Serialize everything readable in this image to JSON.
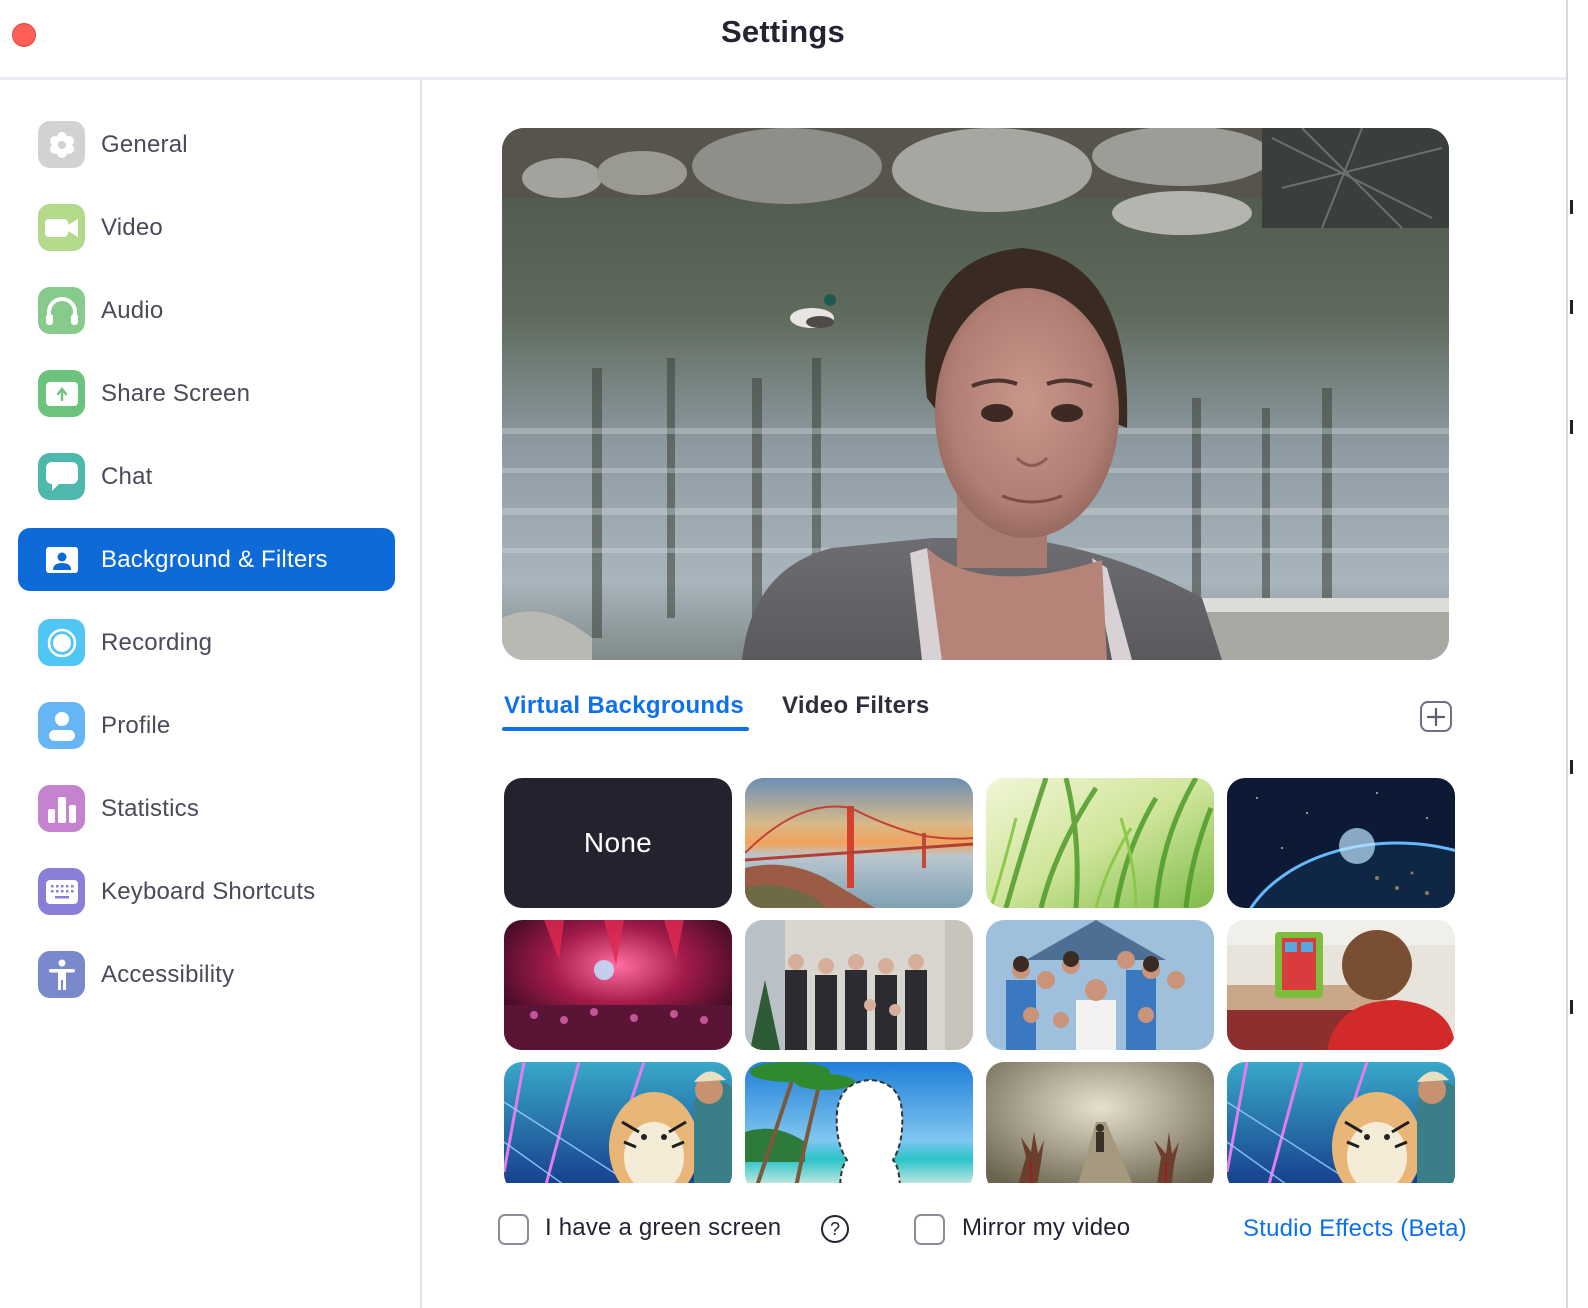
{
  "window": {
    "title": "Settings"
  },
  "sidebar": {
    "items": [
      {
        "id": "general",
        "label": "General",
        "icon": "gear-icon",
        "color": "#d2d2d4",
        "active": false
      },
      {
        "id": "video",
        "label": "Video",
        "icon": "video-camera-icon",
        "color": "#b5d98b",
        "active": false
      },
      {
        "id": "audio",
        "label": "Audio",
        "icon": "headphones-icon",
        "color": "#86cb8b",
        "active": false
      },
      {
        "id": "share-screen",
        "label": "Share Screen",
        "icon": "share-screen-icon",
        "color": "#6cc37b",
        "active": false
      },
      {
        "id": "chat",
        "label": "Chat",
        "icon": "chat-bubble-icon",
        "color": "#4db8ac",
        "active": false
      },
      {
        "id": "background-filters",
        "label": "Background & Filters",
        "icon": "person-card-icon",
        "color": "#0e6ad6",
        "active": true
      },
      {
        "id": "recording",
        "label": "Recording",
        "icon": "record-icon",
        "color": "#4fc6f4",
        "active": false
      },
      {
        "id": "profile",
        "label": "Profile",
        "icon": "person-icon",
        "color": "#66b6f6",
        "active": false
      },
      {
        "id": "statistics",
        "label": "Statistics",
        "icon": "bar-chart-icon",
        "color": "#c583cf",
        "active": false
      },
      {
        "id": "keyboard-shortcuts",
        "label": "Keyboard Shortcuts",
        "icon": "keyboard-icon",
        "color": "#8a7fd6",
        "active": false
      },
      {
        "id": "accessibility",
        "label": "Accessibility",
        "icon": "accessibility-icon",
        "color": "#7a88cc",
        "active": false
      }
    ]
  },
  "main": {
    "preview": {
      "description": "Camera preview: person with virtual background of a pond with rocks and a duck"
    },
    "tabs": [
      {
        "label": "Virtual Backgrounds",
        "active": true
      },
      {
        "label": "Video Filters",
        "active": false
      }
    ],
    "add_button_label": "+",
    "backgrounds": [
      {
        "name": "None",
        "kind": "none",
        "selected": false
      },
      {
        "name": "Golden Gate Bridge",
        "kind": "bridge"
      },
      {
        "name": "Grass",
        "kind": "grass"
      },
      {
        "name": "Earth from space",
        "kind": "space"
      },
      {
        "name": "Concert",
        "kind": "concert"
      },
      {
        "name": "Family photo indoors",
        "kind": "family1"
      },
      {
        "name": "Family photo outdoors",
        "kind": "family2"
      },
      {
        "name": "Child with tablet",
        "kind": "tablet"
      },
      {
        "name": "Tiger King neon",
        "kind": "tiger"
      },
      {
        "name": "Beach silhouette",
        "kind": "beach"
      },
      {
        "name": "Zombie road",
        "kind": "zombie"
      },
      {
        "name": "Tiger King neon 2",
        "kind": "tiger"
      }
    ],
    "green_screen_label": "I have a green screen",
    "green_screen_checked": false,
    "help_label": "?",
    "mirror_label": "Mirror my video",
    "mirror_checked": false,
    "studio_effects_label": "Studio Effects (Beta)"
  },
  "colors": {
    "accent": "#0e71eb",
    "active_nav": "#0e6ad6",
    "close_button": "#fe5f57",
    "none_tile": "#23232f"
  }
}
